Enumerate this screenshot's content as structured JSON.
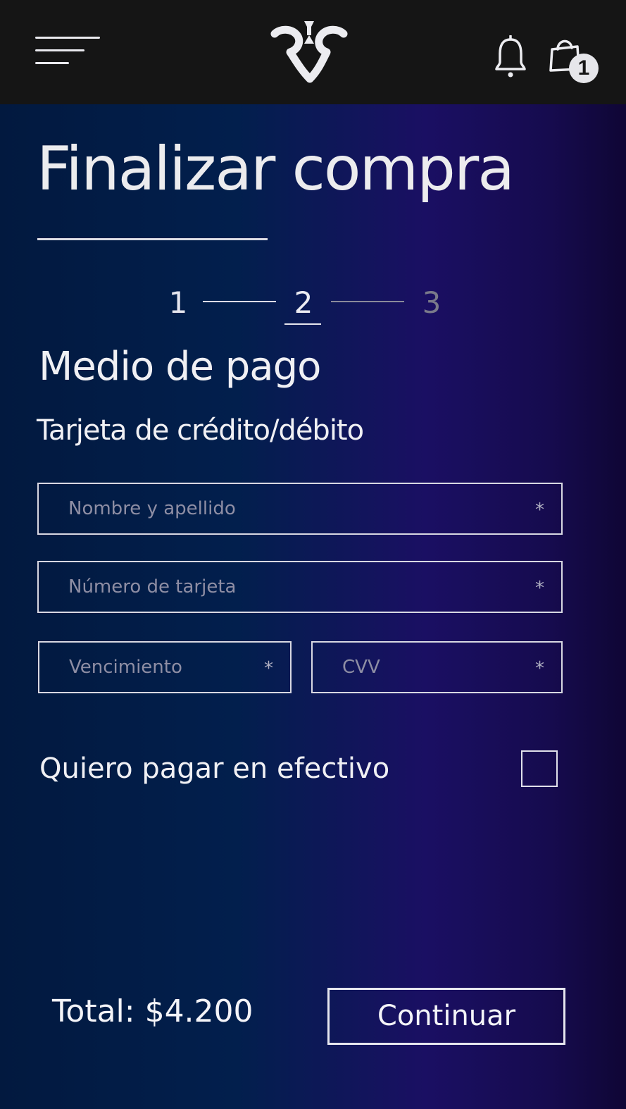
{
  "header": {
    "menu_icon": "hamburger-menu-icon",
    "logo_icon": "brand-logo",
    "bell_icon": "bell-icon",
    "cart_icon": "shopping-bag-icon",
    "cart_count": "1",
    "bar_color": "#151515"
  },
  "page": {
    "title": "Finalizar compra"
  },
  "stepper": {
    "steps": [
      "1",
      "2",
      "3"
    ],
    "current": 2
  },
  "payment": {
    "section_title": "Medio de pago",
    "subtitle": "Tarjeta de crédito/débito",
    "fields": {
      "name": {
        "placeholder": "Nombre y apellido",
        "value": "",
        "required_mark": "*"
      },
      "number": {
        "placeholder": "Número de tarjeta",
        "value": "",
        "required_mark": "*"
      },
      "expiry": {
        "placeholder": "Vencimiento",
        "value": "",
        "required_mark": "*"
      },
      "cvv": {
        "placeholder": "CVV",
        "value": "",
        "required_mark": "*"
      }
    },
    "cash_option": {
      "label": "Quiero pagar en efectivo",
      "checked": false
    }
  },
  "footer": {
    "total": "Total: $4.200",
    "continue_label": "Continuar"
  },
  "colors": {
    "background_left": "#02193f",
    "background_right": "#1a0f63",
    "text": "#f0f0f4",
    "placeholder": "#8e8ea4"
  }
}
